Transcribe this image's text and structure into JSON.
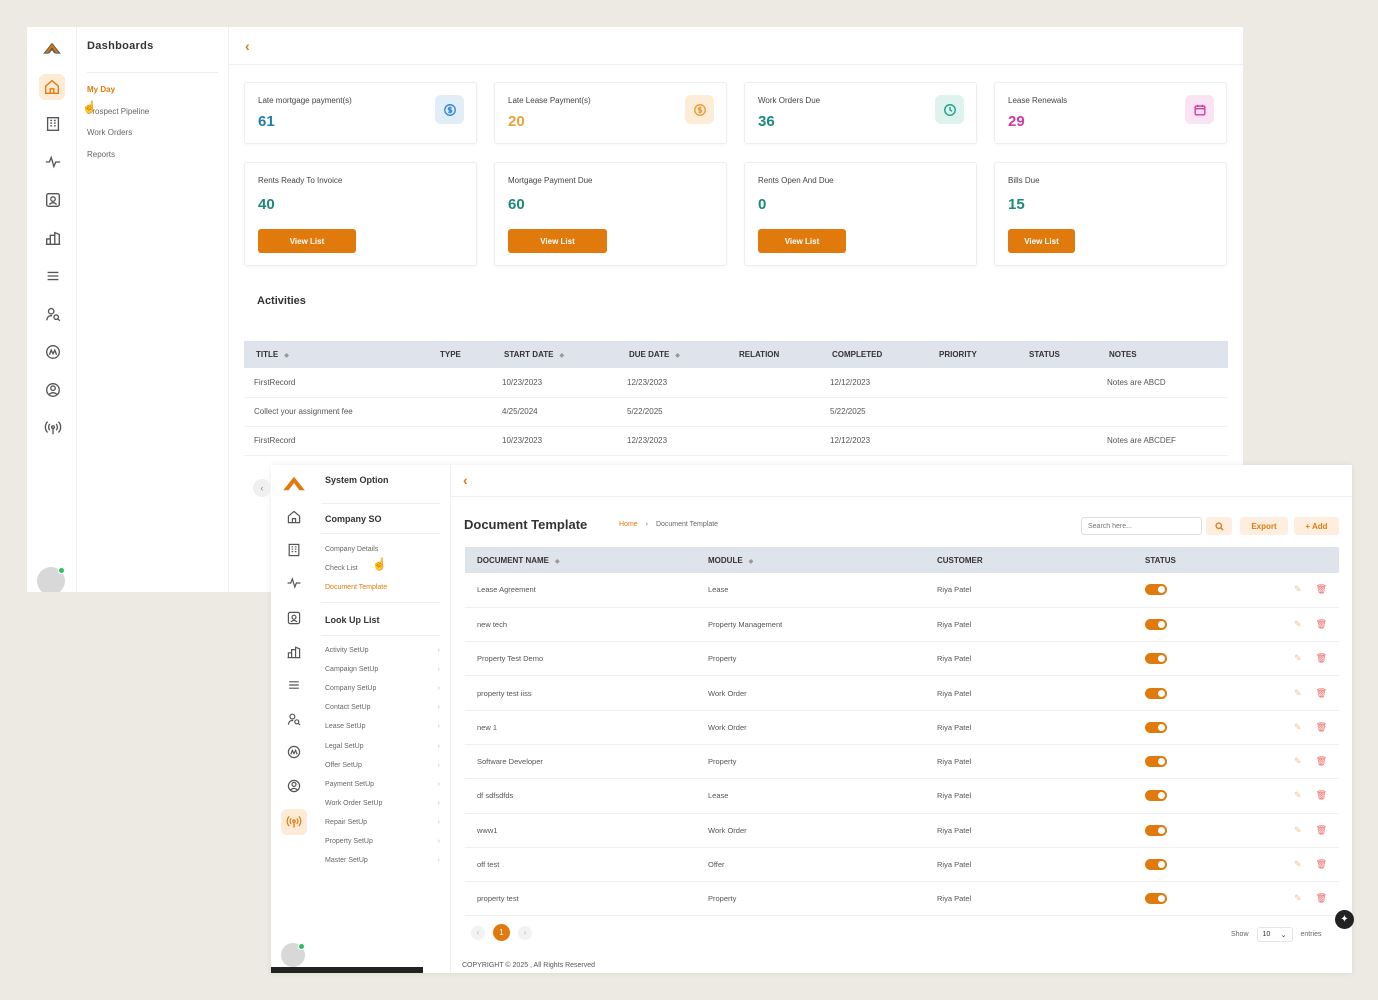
{
  "dash": {
    "sub_title": "Dashboards",
    "sub_items": [
      "My Day",
      "Prospect Pipeline",
      "Work Orders",
      "Reports"
    ],
    "cards_top": [
      {
        "label": "Late mortgage payment(s)",
        "value": "61",
        "color": "#1f7fa8",
        "icon": "dollar-icon",
        "icon_bg": "#e2eef7",
        "icon_color": "#3a8bd1"
      },
      {
        "label": "Late Lease Payment(s)",
        "value": "20",
        "color": "#e8a13b",
        "icon": "dollar-icon",
        "icon_bg": "#fdecd8",
        "icon_color": "#e8a13b"
      },
      {
        "label": "Work Orders Due",
        "value": "36",
        "color": "#1d8a78",
        "icon": "clock-icon",
        "icon_bg": "#dff3ee",
        "icon_color": "#22a38a"
      },
      {
        "label": "Lease Renewals",
        "value": "29",
        "color": "#d13aa0",
        "icon": "calendar-icon",
        "icon_bg": "#fbe3f3",
        "icon_color": "#d13aa0"
      }
    ],
    "cards_bottom": [
      {
        "label": "Rents Ready To Invoice",
        "value": "40",
        "btn": "View List"
      },
      {
        "label": "Mortgage Payment Due",
        "value": "60",
        "btn": "View List"
      },
      {
        "label": "Rents Open And Due",
        "value": "0",
        "btn": "View List"
      },
      {
        "label": "Bills Due",
        "value": "15",
        "btn": "View List"
      }
    ],
    "value_color_bottom": "#1d8a78",
    "activities_title": "Activities",
    "act_headers": [
      "TITLE",
      "TYPE",
      "START DATE",
      "DUE DATE",
      "RELATION",
      "COMPLETED",
      "PRIORITY",
      "STATUS",
      "NOTES"
    ],
    "act_rows": [
      [
        "FirstRecord",
        "",
        "10/23/2023",
        "12/23/2023",
        "",
        "12/12/2023",
        "",
        "",
        "Notes are ABCD"
      ],
      [
        "Collect your assignment fee",
        "",
        "4/25/2024",
        "5/22/2025",
        "",
        "5/22/2025",
        "",
        "",
        ""
      ],
      [
        "FirstRecord",
        "",
        "10/23/2023",
        "12/23/2023",
        "",
        "12/12/2023",
        "",
        "",
        "Notes are ABCDEF"
      ]
    ]
  },
  "doc": {
    "nav": {
      "system_option": "System Option",
      "company_so": "Company SO",
      "company_details": "Company Details",
      "check_list": "Check List",
      "document_template": "Document Template",
      "look_up_list": "Look Up List",
      "lookups": [
        "Activity SetUp",
        "Campaign SetUp",
        "Company SetUp",
        "Contact SetUp",
        "Lease SetUp",
        "Legal SetUp",
        "Offer SetUp",
        "Payment SetUp",
        "Work Order SetUp",
        "Repair SetUp",
        "Property SetUp",
        "Master SetUp"
      ]
    },
    "title": "Document Template",
    "breadcrumb_home": "Home",
    "breadcrumb_current": "Document Template",
    "search_placeholder": "Search here...",
    "export": "Export",
    "add": "+ Add",
    "headers": [
      "DOCUMENT NAME",
      "MODULE",
      "CUSTOMER",
      "STATUS"
    ],
    "rows": [
      [
        "Lease Agreement",
        "Lease",
        "Riya Patel"
      ],
      [
        "new tech",
        "Property Management",
        "Riya Patel"
      ],
      [
        "Property Test Demo",
        "Property",
        "Riya Patel"
      ],
      [
        "property test iiss",
        "Work Order",
        "Riya Patel"
      ],
      [
        "new 1",
        "Work Order",
        "Riya Patel"
      ],
      [
        "Software Developer",
        "Property",
        "Riya Patel"
      ],
      [
        "df sdfsdfds",
        "Lease",
        "Riya Patel"
      ],
      [
        "www1",
        "Work Order",
        "Riya Patel"
      ],
      [
        "off test",
        "Offer",
        "Riya Patel"
      ],
      [
        "property test",
        "Property",
        "Riya Patel"
      ]
    ],
    "page": "1",
    "show_label": "Show",
    "page_size": "10",
    "entries_label": "entries",
    "copyright": "COPYRIGHT © 2025 , All Rights Reserved"
  },
  "accent": "#e07a0c"
}
